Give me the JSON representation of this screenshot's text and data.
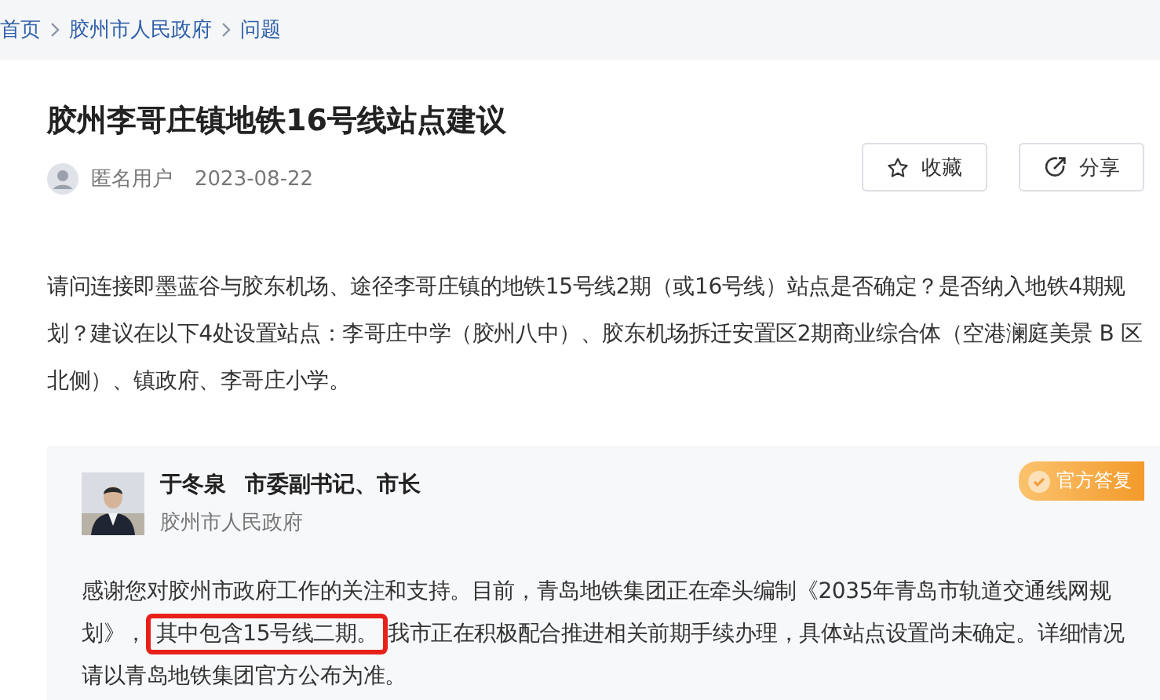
{
  "breadcrumb": [
    "首页",
    "胶州市人民政府",
    "问题"
  ],
  "title": "胶州李哥庄镇地铁16号线站点建议",
  "author": {
    "name": "匿名用户",
    "date": "2023-08-22"
  },
  "actions": [
    "收藏",
    "分享"
  ],
  "question": "请问连接即墨蓝谷与胶东机场、途径李哥庄镇的地铁15号线2期（或16号线）站点是否确定？是否纳入地铁4期规划？建议在以下4处设置站点：李哥庄中学（胶州八中）、胶东机场拆迁安置区2期商业综合体（空港澜庭美景 B 区北侧）、镇政府、李哥庄小学。",
  "reply": {
    "name": "于冬泉",
    "position": "市委副书记、市长",
    "org": "胶州市人民政府",
    "badge": "官方答复",
    "before": "感谢您对胶州市政府工作的关注和支持。目前，青岛地铁集团正在牵头编制《2035年青岛市轨道交通线网规划》，",
    "highlighted": "其中包含15号线二期。",
    "after": "我市正在积极配合推进相关前期手续办理，具体站点设置尚未确定。详细情况请以青岛地铁集团官方公布为准。"
  }
}
